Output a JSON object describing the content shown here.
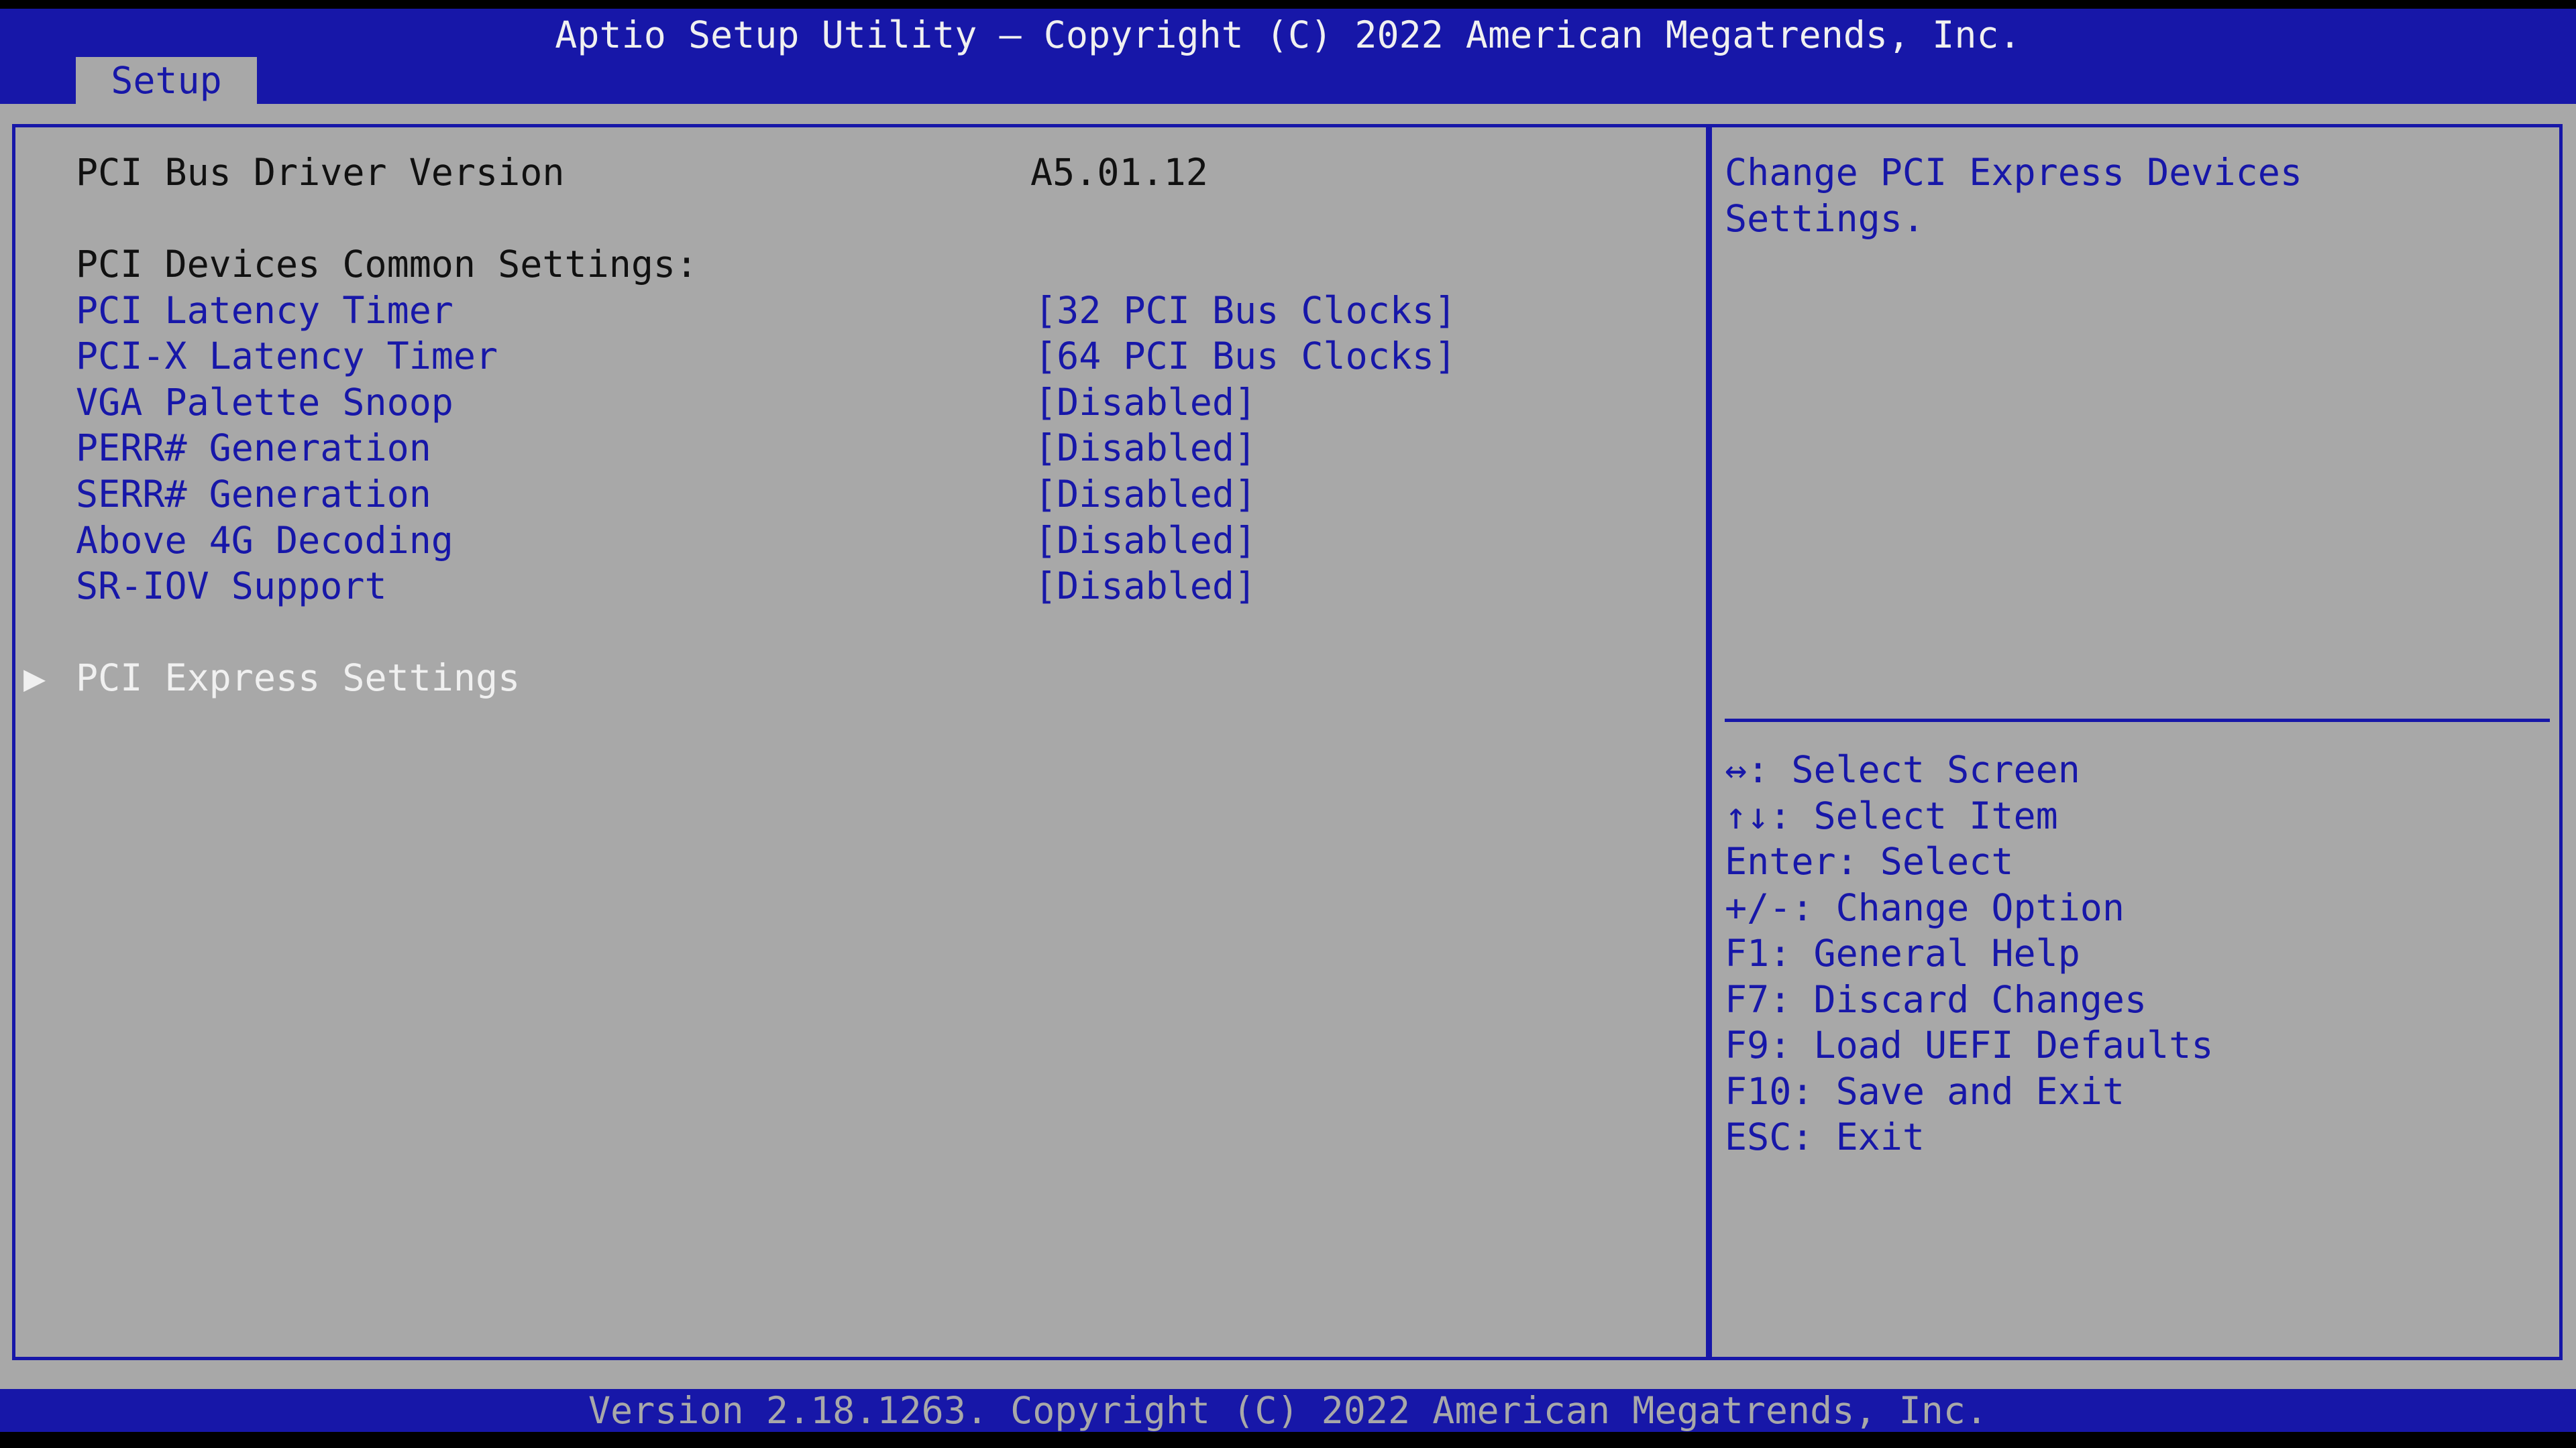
{
  "header": {
    "title": "Aptio Setup Utility – Copyright (C) 2022 American Megatrends, Inc.",
    "tab": "Setup"
  },
  "main": {
    "driver_version_label": "PCI Bus Driver Version",
    "driver_version_value": "A5.01.12",
    "common_settings_heading": "PCI Devices Common Settings:",
    "options": [
      {
        "label": "PCI Latency Timer",
        "value": "[32 PCI Bus Clocks]"
      },
      {
        "label": "PCI-X Latency Timer",
        "value": "[64 PCI Bus Clocks]"
      },
      {
        "label": "VGA Palette Snoop",
        "value": "[Disabled]"
      },
      {
        "label": "PERR# Generation",
        "value": "[Disabled]"
      },
      {
        "label": "SERR# Generation",
        "value": "[Disabled]"
      },
      {
        "label": "Above 4G Decoding",
        "value": "[Disabled]"
      },
      {
        "label": "SR-IOV Support",
        "value": "[Disabled]"
      }
    ],
    "submenu_arrow": "▶",
    "submenu_label": "PCI Express Settings"
  },
  "help": {
    "line1": "Change PCI Express Devices",
    "line2": "Settings."
  },
  "key_hints": [
    "↔: Select Screen",
    "↑↓: Select Item",
    "Enter: Select",
    "+/-: Change Option",
    "F1: General Help",
    "F7: Discard Changes",
    "F9: Load UEFI Defaults",
    "F10: Save and Exit",
    "ESC: Exit"
  ],
  "footer": {
    "text": "Version 2.18.1263. Copyright (C) 2022 American Megatrends, Inc."
  },
  "colors": {
    "bios_blue": "#1717a8",
    "panel_gray": "#a8a8a8",
    "highlight_white": "#f0f0f0",
    "text_dark": "#111111"
  }
}
